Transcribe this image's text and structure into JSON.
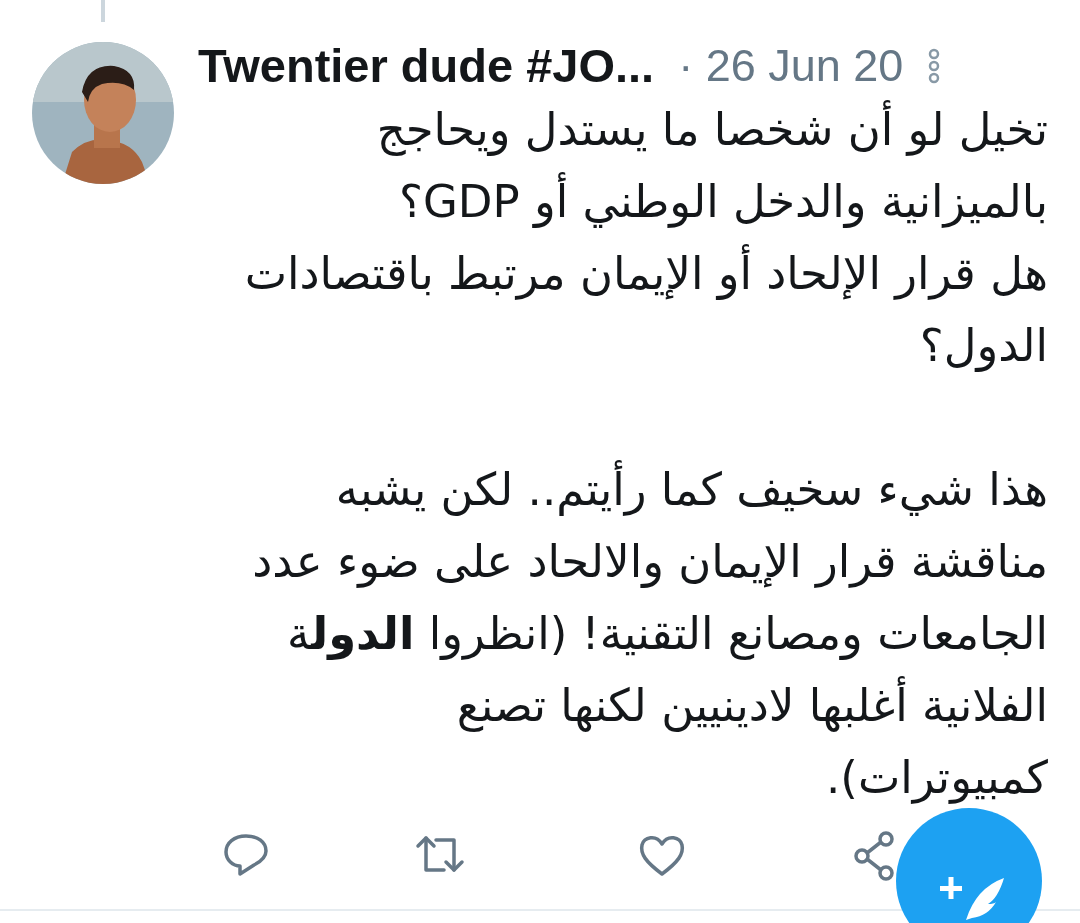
{
  "tweet": {
    "author": "Twentier dude #JO...",
    "date": "· 26 Jun 20",
    "paragraphs": [
      "تخيل لو أن شخصا ما يستدل ويحاجج\nبالميزانية والدخل الوطني أو GDP؟\nهل قرار الإلحاد أو الإيمان مرتبط باقتصادات\nالدول؟",
      "هذا شيء سخيف كما رأيتم.. لكن يشبه\nمناقشة قرار الإيمان والالحاد على ضوء عدد\nالجامعات ومصانع التقنية! (انظروا **الدول**ة\nالفلانية أغلبها لادينيين لكنها تصنع\nكمبيوترات)."
    ],
    "actions": [
      {
        "kind": "reply"
      },
      {
        "kind": "retweet"
      },
      {
        "kind": "like"
      },
      {
        "kind": "share"
      }
    ]
  },
  "compose_button": {
    "kind": "compose"
  }
}
